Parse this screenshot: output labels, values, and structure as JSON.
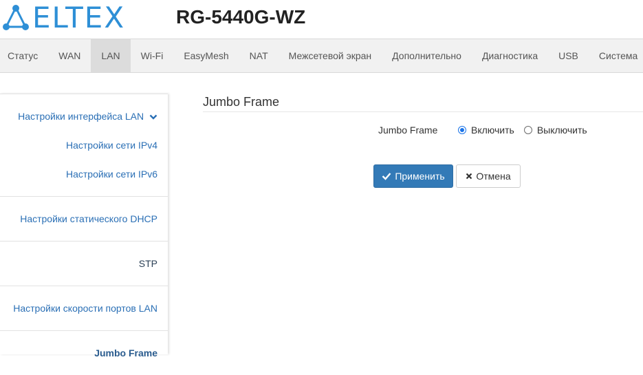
{
  "header": {
    "logo_text": "ELTEX",
    "model": "RG-5440G-WZ"
  },
  "topnav": {
    "tabs": [
      {
        "label": "Статус"
      },
      {
        "label": "WAN"
      },
      {
        "label": "LAN",
        "active": true
      },
      {
        "label": "Wi-Fi"
      },
      {
        "label": "EasyMesh"
      },
      {
        "label": "NAT"
      },
      {
        "label": "Межсетевой экран"
      },
      {
        "label": "Дополнительно"
      },
      {
        "label": "Диагностика"
      },
      {
        "label": "USB"
      },
      {
        "label": "Система"
      }
    ]
  },
  "sidebar": {
    "lan_interface": "Настройки интерфейса LAN",
    "ipv4": "Настройки сети IPv4",
    "ipv6": "Настройки сети IPv6",
    "static_dhcp": "Настройки статического DHCP",
    "stp": "STP",
    "port_speed": "Настройки скорости портов LAN",
    "jumbo_frame": "Jumbo Frame"
  },
  "main": {
    "section_title": "Jumbo Frame",
    "field_label": "Jumbo Frame",
    "option_enable": "Включить",
    "option_disable": "Выключить",
    "selected": "enable",
    "apply_label": "Применить",
    "cancel_label": "Отмена"
  },
  "colors": {
    "brand": "#2e8fd6",
    "link": "#2a6fb5",
    "primary_button": "#337ab7",
    "nav_background": "#f1f1f1",
    "nav_active": "#dcdcdc"
  }
}
